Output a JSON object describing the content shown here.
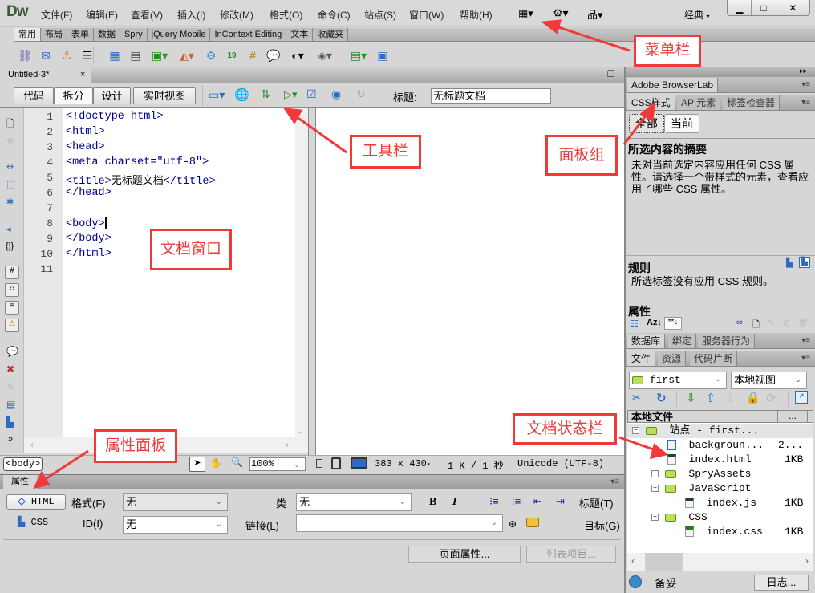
{
  "app": {
    "logo": "Dw",
    "workspace": "经典"
  },
  "menu": [
    "文件(F)",
    "编辑(E)",
    "查看(V)",
    "插入(I)",
    "修改(M)",
    "格式(O)",
    "命令(C)",
    "站点(S)",
    "窗口(W)",
    "帮助(H)"
  ],
  "window_controls": {
    "minimize": "▁",
    "maximize": "□",
    "close": "✕"
  },
  "insert_tabs": [
    "常用",
    "布局",
    "表单",
    "数据",
    "Spry",
    "jQuery Mobile",
    "InContext Editing",
    "文本",
    "收藏夹"
  ],
  "insert_icons": [
    "hyperlink-icon",
    "email-link-icon",
    "named-anchor-icon",
    "horizontal-rule-icon",
    "table-icon",
    "insert-div-icon",
    "images-icon",
    "media-icon",
    "widget-icon",
    "date-icon",
    "server-include-icon",
    "comment-icon",
    "head-icon",
    "script-icon",
    "templates-icon",
    "tag-chooser-icon"
  ],
  "document": {
    "tab_name": "Untitled-3*",
    "view_buttons": [
      "代码",
      "拆分",
      "设计",
      "实时视图"
    ],
    "active_view": "拆分",
    "title_label": "标题:",
    "title_value": "无标题文档"
  },
  "code": {
    "line_numbers": [
      "1",
      "2",
      "3",
      "4",
      "5",
      "6",
      "7",
      "8",
      "9",
      "10",
      "11"
    ],
    "lines": [
      {
        "pre": "<!doctype html>",
        "cn": "",
        "post": ""
      },
      {
        "pre": "<html>",
        "cn": "",
        "post": ""
      },
      {
        "pre": "<head>",
        "cn": "",
        "post": ""
      },
      {
        "pre": "<meta charset=\"utf-8\">",
        "cn": "",
        "post": ""
      },
      {
        "pre": "<title>",
        "cn": "无标题文档",
        "post": "</title>"
      },
      {
        "pre": "</head>",
        "cn": "",
        "post": ""
      },
      {
        "pre": "",
        "cn": "",
        "post": ""
      },
      {
        "pre": "<body>",
        "cn": "",
        "post": ""
      },
      {
        "pre": "</body>",
        "cn": "",
        "post": ""
      },
      {
        "pre": "</html>",
        "cn": "",
        "post": ""
      },
      {
        "pre": "",
        "cn": "",
        "post": ""
      }
    ]
  },
  "status": {
    "tag": "<body>",
    "zoom": "100%",
    "dimensions": "383 x 430",
    "size_time": "1 K / 1 秒",
    "encoding": "Unicode (UTF-8)"
  },
  "properties": {
    "tab": "属性",
    "html_btn": "HTML",
    "css_btn": "CSS",
    "format_label": "格式(F)",
    "format_value": "无",
    "class_label": "类",
    "class_value": "无",
    "id_label": "ID(I)",
    "id_value": "无",
    "link_label": "链接(L)",
    "link_value": "",
    "title_label": "标题(T)",
    "target_label": "目标(G)",
    "bold": "B",
    "italic": "I",
    "page_props_btn": "页面属性...",
    "list_item_btn": "列表项目..."
  },
  "panels": {
    "browserlab": "Adobe BrowserLab",
    "css_tabs": [
      "CSS样式",
      "AP 元素",
      "标签检查器"
    ],
    "mode_buttons": [
      "全部",
      "当前"
    ],
    "summary_title": "所选内容的摘要",
    "summary_text": "未对当前选定内容应用任何 CSS 属性。请选择一个带样式的元素，查看应用了哪些 CSS 属性。",
    "rules_title": "规则",
    "rules_text": "所选标签没有应用 CSS 规则。",
    "props_title": "属性",
    "data_tabs": [
      "数据库",
      "绑定",
      "服务器行为"
    ],
    "file_tabs": [
      "文件",
      "资源",
      "代码片断"
    ],
    "site_select": "first",
    "view_select": "本地视图",
    "local_files_header": "本地文件",
    "size_header": "...",
    "tree": [
      {
        "level": 0,
        "type": "folder",
        "toggle": "-",
        "name": "站点 - first...",
        "size": ""
      },
      {
        "level": 1,
        "type": "image",
        "toggle": "",
        "name": "backgroun...",
        "size": "2..."
      },
      {
        "level": 1,
        "type": "html",
        "toggle": "",
        "name": "index.html",
        "size": "1KB"
      },
      {
        "level": 1,
        "type": "folder",
        "toggle": "+",
        "name": "SpryAssets",
        "size": ""
      },
      {
        "level": 1,
        "type": "folder",
        "toggle": "-",
        "name": "JavaScript",
        "size": ""
      },
      {
        "level": 2,
        "type": "js",
        "toggle": "",
        "name": "index.js",
        "size": "1KB"
      },
      {
        "level": 1,
        "type": "folder",
        "toggle": "-",
        "name": "CSS",
        "size": ""
      },
      {
        "level": 2,
        "type": "css",
        "toggle": "",
        "name": "index.css",
        "size": "1KB"
      }
    ],
    "footer_status": "备妥",
    "log_btn": "日志..."
  },
  "annotations": {
    "menubar": "菜单栏",
    "toolbar": "工具栏",
    "panel_group": "面板组",
    "document_window": "文档窗口",
    "property_panel": "属性面板",
    "doc_statusbar": "文档状态栏"
  },
  "colors": {
    "annotation": "#f03a3a",
    "code_tag": "#00008b",
    "logo": "#3e5a3c"
  }
}
